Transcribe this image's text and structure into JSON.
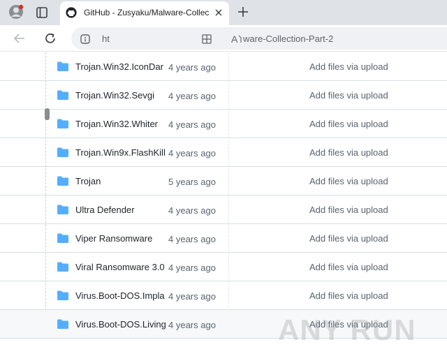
{
  "browser": {
    "tab_title": "GitHub - Zusyaku/Malware-Collec",
    "url_prefix": "ht",
    "url_suffix": "ware-Collection-Part-2",
    "icons": [
      "profile-icon",
      "tab-actions-icon",
      "github-icon",
      "close-icon",
      "new-tab-icon",
      "back-icon",
      "reload-icon",
      "site-info-icon",
      "apps-icon",
      "reader-icon"
    ]
  },
  "files": [
    {
      "name": "Trojan.Win32.IconDar",
      "date": "4 years ago",
      "message": "Add files via upload"
    },
    {
      "name": "Trojan.Win32.Sevgi",
      "date": "4 years ago",
      "message": "Add files via upload"
    },
    {
      "name": "Trojan.Win32.Whiter",
      "date": "4 years ago",
      "message": "Add files via upload"
    },
    {
      "name": "Trojan.Win9x.FlashKill",
      "date": "4 years ago",
      "message": "Add files via upload"
    },
    {
      "name": "Trojan",
      "date": "5 years ago",
      "message": "Add files via upload"
    },
    {
      "name": "Ultra Defender",
      "date": "4 years ago",
      "message": "Add files via upload"
    },
    {
      "name": "Viper Ransomware",
      "date": "4 years ago",
      "message": "Add files via upload"
    },
    {
      "name": "Viral Ransomware 3.0",
      "date": "4 years ago",
      "message": "Add files via upload"
    },
    {
      "name": "Virus.Boot-DOS.Impla",
      "date": "4 years ago",
      "message": "Add files via upload"
    },
    {
      "name": "Virus.Boot-DOS.Living",
      "date": "4 years ago",
      "message": "Add files via upload"
    }
  ],
  "watermark": {
    "text": "ANY RUN"
  },
  "colors": {
    "folder": "#54aeff",
    "tabbar": "#dfe3e8",
    "row_hover": "#f6f8fa"
  }
}
